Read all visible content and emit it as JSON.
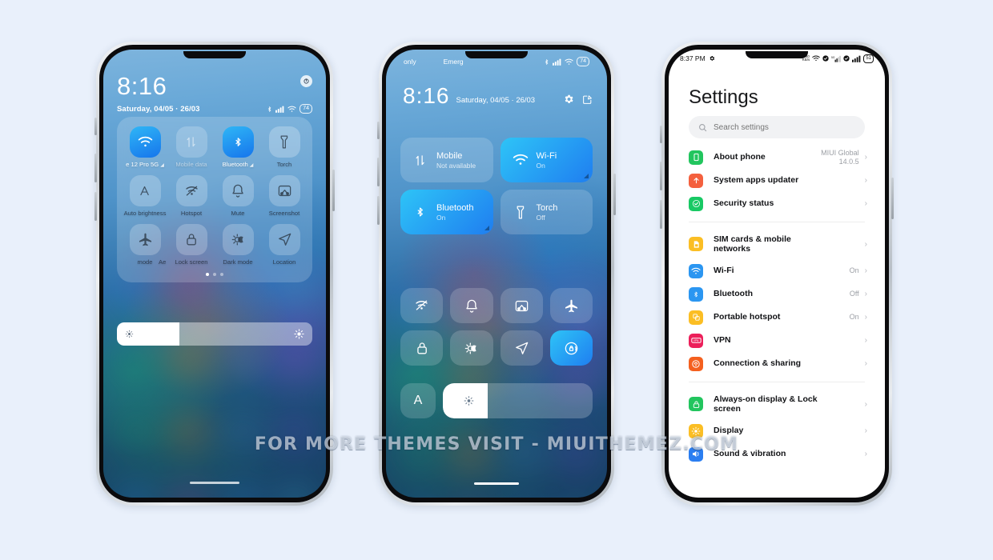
{
  "page": {
    "background_color": "#e9f0fb",
    "watermark": "FOR MORE THEMES VISIT - MIUITHEMEZ.COM"
  },
  "phone1": {
    "status": {
      "clock": "8:16",
      "date": "Saturday, 04/05 · 26/03",
      "icons": [
        "bluetooth-icon",
        "signal-icon",
        "wifi-icon"
      ],
      "battery": "74",
      "power_icon": "power-button-icon"
    },
    "tiles": [
      {
        "label": "e 12 Pro 5G",
        "icon": "wifi-icon",
        "state": "on",
        "arrow": true
      },
      {
        "label": "Mobile data",
        "icon": "mobile-data-icon",
        "state": "dim",
        "arrow": false
      },
      {
        "label": "Bluetooth",
        "icon": "bluetooth-icon",
        "state": "on",
        "arrow": true
      },
      {
        "label": "Torch",
        "icon": "torch-icon",
        "state": "off",
        "arrow": false
      },
      {
        "label": "Auto brightness",
        "icon": "auto-brightness-icon",
        "state": "off",
        "arrow": false
      },
      {
        "label": "Hotspot",
        "icon": "hotspot-icon",
        "state": "off",
        "arrow": false
      },
      {
        "label": "Mute",
        "icon": "bell-icon",
        "state": "off",
        "arrow": false
      },
      {
        "label": "Screenshot",
        "icon": "screenshot-icon",
        "state": "off",
        "arrow": false
      },
      {
        "label": "mode",
        "icon": "airplane-icon",
        "state": "off",
        "arrow": false
      },
      {
        "label": "Lock screen",
        "icon": "lock-icon",
        "state": "off",
        "arrow": false
      },
      {
        "label": "Dark mode",
        "icon": "dark-mode-icon",
        "state": "off",
        "arrow": false
      },
      {
        "label": "Location",
        "icon": "location-icon",
        "state": "off",
        "arrow": false
      }
    ],
    "overflow_label": "Ae",
    "page_dots": {
      "count": 3,
      "active": 0
    },
    "brightness": {
      "value_pct": 32,
      "left_icon": "brightness-low-icon",
      "right_icon": "brightness-high-icon"
    }
  },
  "phone2": {
    "status": {
      "carrier_left": "only",
      "carrier_right": "Emerg",
      "icons": [
        "bluetooth-icon",
        "signal-icon",
        "wifi-icon"
      ],
      "battery": "74"
    },
    "header": {
      "clock": "8:16",
      "date": "Saturday, 04/05 · 26/03",
      "actions": [
        "settings-gear-icon",
        "edit-tiles-icon"
      ]
    },
    "big_tiles": [
      {
        "title": "Mobile",
        "subtitle": "Not available",
        "icon": "mobile-data-icon",
        "state": "off",
        "arrow": false
      },
      {
        "title": "Wi-Fi",
        "subtitle": "On",
        "icon": "wifi-icon",
        "state": "on",
        "arrow": true
      },
      {
        "title": "Bluetooth",
        "subtitle": "On",
        "icon": "bluetooth-icon",
        "state": "on",
        "arrow": true
      },
      {
        "title": "Torch",
        "subtitle": "Off",
        "icon": "torch-icon",
        "state": "off",
        "arrow": false
      }
    ],
    "small_tiles": [
      {
        "icon": "hotspot-icon",
        "state": "off"
      },
      {
        "icon": "bell-icon",
        "state": "off"
      },
      {
        "icon": "screenshot-icon",
        "state": "off"
      },
      {
        "icon": "airplane-icon",
        "state": "off"
      },
      {
        "icon": "lock-icon",
        "state": "off"
      },
      {
        "icon": "dark-mode-icon",
        "state": "off"
      },
      {
        "icon": "location-icon",
        "state": "off"
      },
      {
        "icon": "auto-rotate-icon",
        "state": "on"
      }
    ],
    "auto_brightness_label": "A",
    "brightness": {
      "value_pct": 30,
      "icon": "brightness-icon"
    }
  },
  "phone3": {
    "status": {
      "clock": "8:37 PM",
      "clock_icon": "gear-icon",
      "icons": [
        "data-speed-icon",
        "wifi-icon",
        "check-circle-icon",
        "signal-5g-icon",
        "check-circle-icon",
        "signal-icon"
      ],
      "battery": "51"
    },
    "title": "Settings",
    "search": {
      "placeholder": "Search settings",
      "icon": "search-icon"
    },
    "groups": [
      {
        "items": [
          {
            "name": "About phone",
            "value": "MIUI Global\n14.0.5",
            "icon": "phone-icon",
            "color": "#22c55e"
          },
          {
            "name": "System apps updater",
            "value": "",
            "icon": "upload-icon",
            "color": "#f4603e"
          },
          {
            "name": "Security status",
            "value": "",
            "icon": "shield-check-icon",
            "color": "#18c964"
          }
        ]
      },
      {
        "items": [
          {
            "name": "SIM cards & mobile networks",
            "value": "",
            "icon": "sim-card-icon",
            "color": "#fbbe24"
          },
          {
            "name": "Wi-Fi",
            "value": "On",
            "icon": "wifi-icon",
            "color": "#2b96f1"
          },
          {
            "name": "Bluetooth",
            "value": "Off",
            "icon": "bluetooth-icon",
            "color": "#2b96f1"
          },
          {
            "name": "Portable hotspot",
            "value": "On",
            "icon": "hotspot-icon",
            "color": "#fbbe24"
          },
          {
            "name": "VPN",
            "value": "",
            "icon": "vpn-icon",
            "color": "#ec1f5a"
          },
          {
            "name": "Connection & sharing",
            "value": "",
            "icon": "connection-icon",
            "color": "#f4601f"
          }
        ]
      },
      {
        "items": [
          {
            "name": "Always-on display & Lock screen",
            "value": "",
            "icon": "lock-screen-icon",
            "color": "#22c55e"
          },
          {
            "name": "Display",
            "value": "",
            "icon": "display-icon",
            "color": "#fbbe24"
          },
          {
            "name": "Sound & vibration",
            "value": "",
            "icon": "sound-icon",
            "color": "#2b7ef1"
          }
        ]
      }
    ],
    "chevron": "›"
  }
}
